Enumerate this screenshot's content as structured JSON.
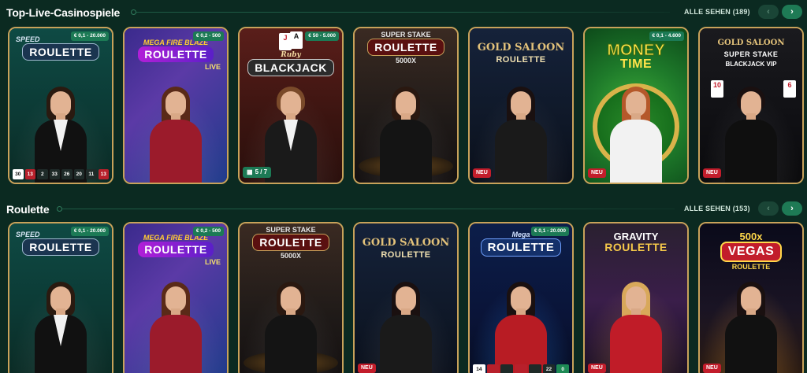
{
  "sections": [
    {
      "title": "Top-Live-Casinospiele",
      "see_all": "ALLE SEHEN (189)",
      "prev_icon": "‹",
      "next_icon": "›",
      "games": [
        {
          "logo_top": "SPEED",
          "logo_main": "ROULETTE",
          "logo_sub": "",
          "limit": "€ 0,1 - 20.000",
          "results": [
            "30",
            "13",
            "2",
            "33",
            "26",
            "20",
            "11",
            "13"
          ]
        },
        {
          "logo_top": "MEGA FIRE BLAZE",
          "logo_main": "ROULETTE",
          "logo_sub": "LIVE",
          "limit": "€ 0,2 - 500"
        },
        {
          "logo_top": "Ruby",
          "logo_main": "BLACKJACK",
          "logo_sub": "",
          "limit": "€ 50 - 5.000",
          "seats": "5 / 7"
        },
        {
          "logo_top": "SUPER STAKE",
          "logo_main": "ROULETTE",
          "logo_sub": "5000X"
        },
        {
          "logo_top": "GOLD SALOON",
          "logo_main": "ROULETTE",
          "logo_sub": "",
          "badge": "NEU"
        },
        {
          "logo_top": "MONEY",
          "logo_main": "TIME",
          "logo_sub": "",
          "limit": "€ 0,1 - 4.600",
          "badge": "NEU"
        },
        {
          "logo_top": "GOLD SALOON",
          "logo_main": "SUPER STAKE",
          "logo_sub": "BLACKJACK VIP",
          "badge": "NEU"
        }
      ]
    },
    {
      "title": "Roulette",
      "see_all": "ALLE SEHEN (153)",
      "prev_icon": "‹",
      "next_icon": "›",
      "games": [
        {
          "logo_top": "SPEED",
          "logo_main": "ROULETTE",
          "logo_sub": "",
          "limit": "€ 0,1 - 20.000"
        },
        {
          "logo_top": "MEGA FIRE BLAZE",
          "logo_main": "ROULETTE",
          "logo_sub": "LIVE",
          "limit": "€ 0,2 - 500"
        },
        {
          "logo_top": "SUPER STAKE",
          "logo_main": "ROULETTE",
          "logo_sub": "5000X"
        },
        {
          "logo_top": "GOLD SALOON",
          "logo_main": "ROULETTE",
          "logo_sub": "",
          "badge": "NEU"
        },
        {
          "logo_top": "Mega",
          "logo_main": "ROULETTE",
          "logo_sub": "",
          "limit": "€ 0,1 - 20.000",
          "results": [
            "14",
            "",
            "",
            "",
            "",
            "22",
            "0"
          ]
        },
        {
          "logo_top": "GRAVITY",
          "logo_main": "ROULETTE",
          "logo_sub": "",
          "badge": "NEU"
        },
        {
          "logo_top": "500x",
          "logo_main": "VEGAS",
          "logo_sub": "ROULETTE",
          "badge": "NEU"
        }
      ]
    }
  ]
}
